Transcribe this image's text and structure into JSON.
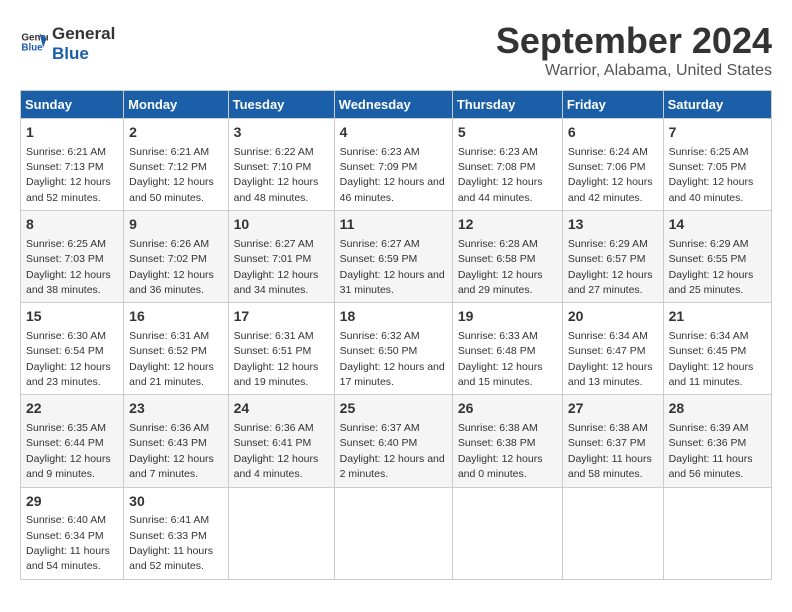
{
  "logo": {
    "line1": "General",
    "line2": "Blue"
  },
  "title": "September 2024",
  "subtitle": "Warrior, Alabama, United States",
  "days_of_week": [
    "Sunday",
    "Monday",
    "Tuesday",
    "Wednesday",
    "Thursday",
    "Friday",
    "Saturday"
  ],
  "weeks": [
    [
      {
        "day": "1",
        "sunrise": "Sunrise: 6:21 AM",
        "sunset": "Sunset: 7:13 PM",
        "daylight": "Daylight: 12 hours and 52 minutes."
      },
      {
        "day": "2",
        "sunrise": "Sunrise: 6:21 AM",
        "sunset": "Sunset: 7:12 PM",
        "daylight": "Daylight: 12 hours and 50 minutes."
      },
      {
        "day": "3",
        "sunrise": "Sunrise: 6:22 AM",
        "sunset": "Sunset: 7:10 PM",
        "daylight": "Daylight: 12 hours and 48 minutes."
      },
      {
        "day": "4",
        "sunrise": "Sunrise: 6:23 AM",
        "sunset": "Sunset: 7:09 PM",
        "daylight": "Daylight: 12 hours and 46 minutes."
      },
      {
        "day": "5",
        "sunrise": "Sunrise: 6:23 AM",
        "sunset": "Sunset: 7:08 PM",
        "daylight": "Daylight: 12 hours and 44 minutes."
      },
      {
        "day": "6",
        "sunrise": "Sunrise: 6:24 AM",
        "sunset": "Sunset: 7:06 PM",
        "daylight": "Daylight: 12 hours and 42 minutes."
      },
      {
        "day": "7",
        "sunrise": "Sunrise: 6:25 AM",
        "sunset": "Sunset: 7:05 PM",
        "daylight": "Daylight: 12 hours and 40 minutes."
      }
    ],
    [
      {
        "day": "8",
        "sunrise": "Sunrise: 6:25 AM",
        "sunset": "Sunset: 7:03 PM",
        "daylight": "Daylight: 12 hours and 38 minutes."
      },
      {
        "day": "9",
        "sunrise": "Sunrise: 6:26 AM",
        "sunset": "Sunset: 7:02 PM",
        "daylight": "Daylight: 12 hours and 36 minutes."
      },
      {
        "day": "10",
        "sunrise": "Sunrise: 6:27 AM",
        "sunset": "Sunset: 7:01 PM",
        "daylight": "Daylight: 12 hours and 34 minutes."
      },
      {
        "day": "11",
        "sunrise": "Sunrise: 6:27 AM",
        "sunset": "Sunset: 6:59 PM",
        "daylight": "Daylight: 12 hours and 31 minutes."
      },
      {
        "day": "12",
        "sunrise": "Sunrise: 6:28 AM",
        "sunset": "Sunset: 6:58 PM",
        "daylight": "Daylight: 12 hours and 29 minutes."
      },
      {
        "day": "13",
        "sunrise": "Sunrise: 6:29 AM",
        "sunset": "Sunset: 6:57 PM",
        "daylight": "Daylight: 12 hours and 27 minutes."
      },
      {
        "day": "14",
        "sunrise": "Sunrise: 6:29 AM",
        "sunset": "Sunset: 6:55 PM",
        "daylight": "Daylight: 12 hours and 25 minutes."
      }
    ],
    [
      {
        "day": "15",
        "sunrise": "Sunrise: 6:30 AM",
        "sunset": "Sunset: 6:54 PM",
        "daylight": "Daylight: 12 hours and 23 minutes."
      },
      {
        "day": "16",
        "sunrise": "Sunrise: 6:31 AM",
        "sunset": "Sunset: 6:52 PM",
        "daylight": "Daylight: 12 hours and 21 minutes."
      },
      {
        "day": "17",
        "sunrise": "Sunrise: 6:31 AM",
        "sunset": "Sunset: 6:51 PM",
        "daylight": "Daylight: 12 hours and 19 minutes."
      },
      {
        "day": "18",
        "sunrise": "Sunrise: 6:32 AM",
        "sunset": "Sunset: 6:50 PM",
        "daylight": "Daylight: 12 hours and 17 minutes."
      },
      {
        "day": "19",
        "sunrise": "Sunrise: 6:33 AM",
        "sunset": "Sunset: 6:48 PM",
        "daylight": "Daylight: 12 hours and 15 minutes."
      },
      {
        "day": "20",
        "sunrise": "Sunrise: 6:34 AM",
        "sunset": "Sunset: 6:47 PM",
        "daylight": "Daylight: 12 hours and 13 minutes."
      },
      {
        "day": "21",
        "sunrise": "Sunrise: 6:34 AM",
        "sunset": "Sunset: 6:45 PM",
        "daylight": "Daylight: 12 hours and 11 minutes."
      }
    ],
    [
      {
        "day": "22",
        "sunrise": "Sunrise: 6:35 AM",
        "sunset": "Sunset: 6:44 PM",
        "daylight": "Daylight: 12 hours and 9 minutes."
      },
      {
        "day": "23",
        "sunrise": "Sunrise: 6:36 AM",
        "sunset": "Sunset: 6:43 PM",
        "daylight": "Daylight: 12 hours and 7 minutes."
      },
      {
        "day": "24",
        "sunrise": "Sunrise: 6:36 AM",
        "sunset": "Sunset: 6:41 PM",
        "daylight": "Daylight: 12 hours and 4 minutes."
      },
      {
        "day": "25",
        "sunrise": "Sunrise: 6:37 AM",
        "sunset": "Sunset: 6:40 PM",
        "daylight": "Daylight: 12 hours and 2 minutes."
      },
      {
        "day": "26",
        "sunrise": "Sunrise: 6:38 AM",
        "sunset": "Sunset: 6:38 PM",
        "daylight": "Daylight: 12 hours and 0 minutes."
      },
      {
        "day": "27",
        "sunrise": "Sunrise: 6:38 AM",
        "sunset": "Sunset: 6:37 PM",
        "daylight": "Daylight: 11 hours and 58 minutes."
      },
      {
        "day": "28",
        "sunrise": "Sunrise: 6:39 AM",
        "sunset": "Sunset: 6:36 PM",
        "daylight": "Daylight: 11 hours and 56 minutes."
      }
    ],
    [
      {
        "day": "29",
        "sunrise": "Sunrise: 6:40 AM",
        "sunset": "Sunset: 6:34 PM",
        "daylight": "Daylight: 11 hours and 54 minutes."
      },
      {
        "day": "30",
        "sunrise": "Sunrise: 6:41 AM",
        "sunset": "Sunset: 6:33 PM",
        "daylight": "Daylight: 11 hours and 52 minutes."
      },
      null,
      null,
      null,
      null,
      null
    ]
  ]
}
